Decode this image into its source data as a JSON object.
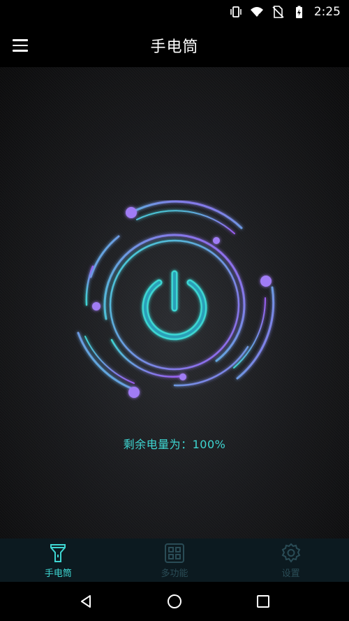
{
  "status_bar": {
    "time": "2:25",
    "icons": [
      "vibrate-icon",
      "wifi-icon",
      "no-sim-icon",
      "battery-charging-icon"
    ]
  },
  "app_bar": {
    "title": "手电筒",
    "menu_icon": "hamburger-menu-icon"
  },
  "main": {
    "power_icon": "power-icon",
    "battery_label": "剩余电量为：100%"
  },
  "bottom_nav": {
    "tabs": [
      {
        "label": "手电筒",
        "icon": "flashlight-icon",
        "active": true
      },
      {
        "label": "多功能",
        "icon": "grid-icon",
        "active": false
      },
      {
        "label": "设置",
        "icon": "gear-icon",
        "active": false
      }
    ]
  },
  "system_nav": [
    "back-icon",
    "home-icon",
    "recents-icon"
  ],
  "colors": {
    "accent": "#3ed6d2",
    "purple": "#9b5cf0",
    "inactive": "#2a4c56",
    "nav_bg": "#0c1a20"
  }
}
